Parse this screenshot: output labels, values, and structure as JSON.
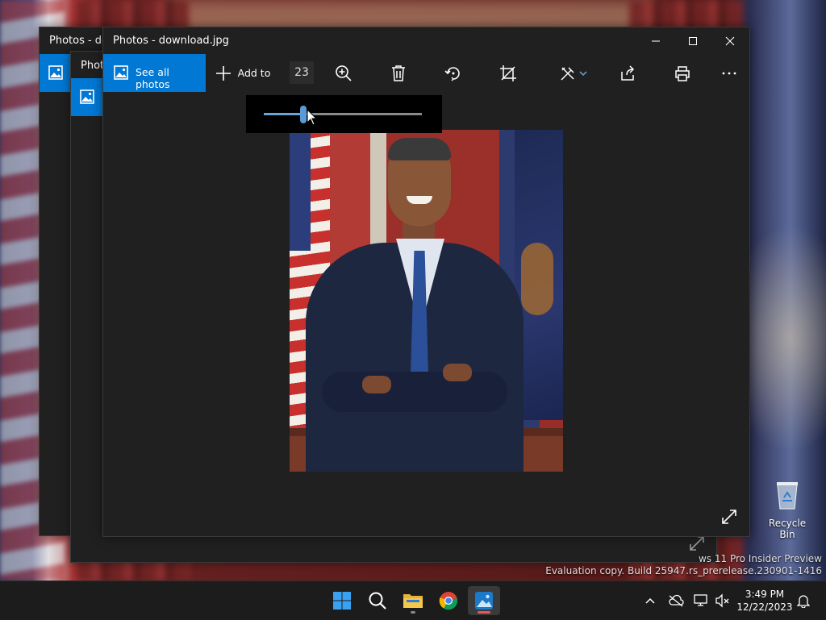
{
  "windows": {
    "back1": {
      "title": "Photos - download.jpg"
    },
    "back2": {
      "title": "Photos - download.jpg"
    },
    "main": {
      "title": "Photos - download.jpg"
    }
  },
  "toolbar": {
    "see_all_photos": "See all photos",
    "add_to": "Add to",
    "zoom_value": "23"
  },
  "zoom_slider": {
    "value_fraction": 0.25
  },
  "desktop": {
    "recycle_bin": "Recycle Bin",
    "watermark_line1": "ws 11 Pro Insider Preview",
    "watermark_line2": "Evaluation copy. Build 25947.rs_prerelease.230901-1416"
  },
  "taskbar": {
    "time": "3:49 PM",
    "date": "12/22/2023"
  },
  "colors": {
    "accent": "#0078d4",
    "window_bg": "#202020",
    "taskbar_bg": "#1c1c1c"
  },
  "icons": [
    "photos-app-icon",
    "add-icon",
    "zoom-in-icon",
    "delete-icon",
    "rotate-icon",
    "crop-icon",
    "edit-icon",
    "share-icon",
    "print-icon",
    "more-icon",
    "minimize-icon",
    "maximize-icon",
    "close-icon",
    "expand-icon",
    "windows-start-icon",
    "search-icon",
    "file-explorer-icon",
    "chrome-icon",
    "photos-taskbar-icon",
    "chevron-up-icon",
    "onedrive-icon",
    "network-icon",
    "volume-icon",
    "notification-bell-icon",
    "recycle-bin-icon"
  ]
}
